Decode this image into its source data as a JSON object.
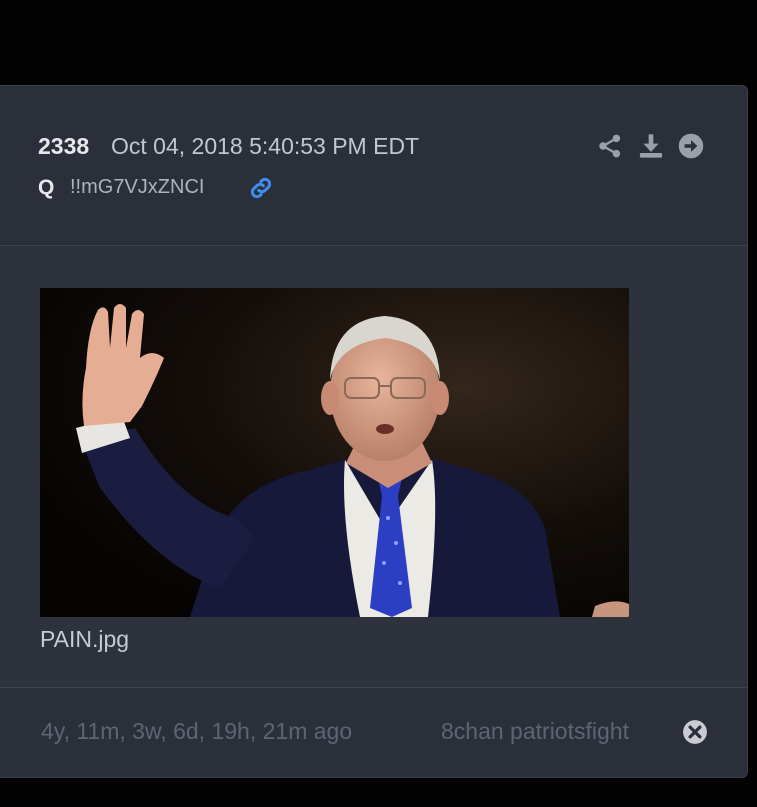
{
  "post": {
    "number": "2338",
    "date": "Oct 04, 2018 5:40:53 PM EDT",
    "author": "Q",
    "tripcode": "!!mG7VJxZNCI",
    "icons": {
      "permalink": "link-icon",
      "share": "share-icon",
      "download": "download-icon",
      "next": "arrow-right-circle-icon"
    }
  },
  "attachment": {
    "filename": "PAIN.jpg"
  },
  "footer": {
    "age": "4y, 11m, 3w, 6d, 19h, 21m ago",
    "source": "8chan patriotsfight",
    "close_icon": "close-circle-icon"
  },
  "colors": {
    "page_background": "#030303",
    "card_background": "#2b2f39",
    "link_accent": "#3d8ef0",
    "muted_text": "#5e6572"
  }
}
